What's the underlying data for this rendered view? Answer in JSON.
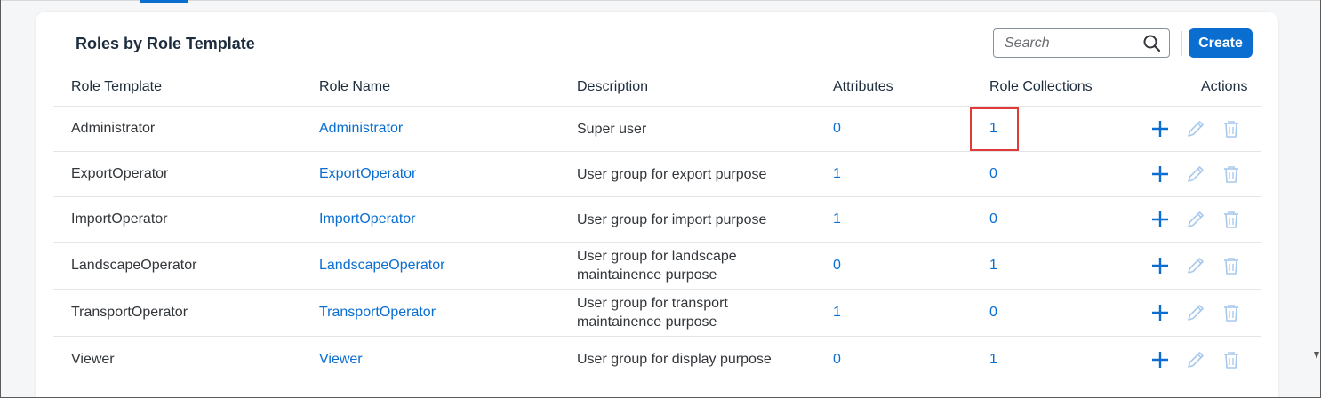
{
  "card": {
    "title": "Roles by Role Template",
    "search_placeholder": "Search",
    "create_label": "Create"
  },
  "table": {
    "columns": {
      "role_template": "Role Template",
      "role_name": "Role Name",
      "description": "Description",
      "attributes": "Attributes",
      "role_collections": "Role Collections",
      "actions": "Actions"
    },
    "rows": [
      {
        "role_template": "Administrator",
        "role_name": "Administrator",
        "description": "Super user",
        "attributes": "0",
        "role_collections": "1"
      },
      {
        "role_template": "ExportOperator",
        "role_name": "ExportOperator",
        "description": "User group for export purpose",
        "attributes": "1",
        "role_collections": "0"
      },
      {
        "role_template": "ImportOperator",
        "role_name": "ImportOperator",
        "description": "User group for import purpose",
        "attributes": "1",
        "role_collections": "0"
      },
      {
        "role_template": "LandscapeOperator",
        "role_name": "LandscapeOperator",
        "description": "User group for landscape maintainence purpose",
        "attributes": "0",
        "role_collections": "1"
      },
      {
        "role_template": "TransportOperator",
        "role_name": "TransportOperator",
        "description": "User group for transport maintainence purpose",
        "attributes": "1",
        "role_collections": "0"
      },
      {
        "role_template": "Viewer",
        "role_name": "Viewer",
        "description": "User group for display purpose",
        "attributes": "0",
        "role_collections": "1"
      }
    ]
  },
  "icons": {
    "search": "search-icon",
    "add": "add-icon",
    "edit": "pencil-icon",
    "delete": "trash-icon"
  },
  "colors": {
    "accent": "#0a6ed1",
    "highlight": "#e03a3a",
    "disabled_icon": "#a9c9ec"
  }
}
